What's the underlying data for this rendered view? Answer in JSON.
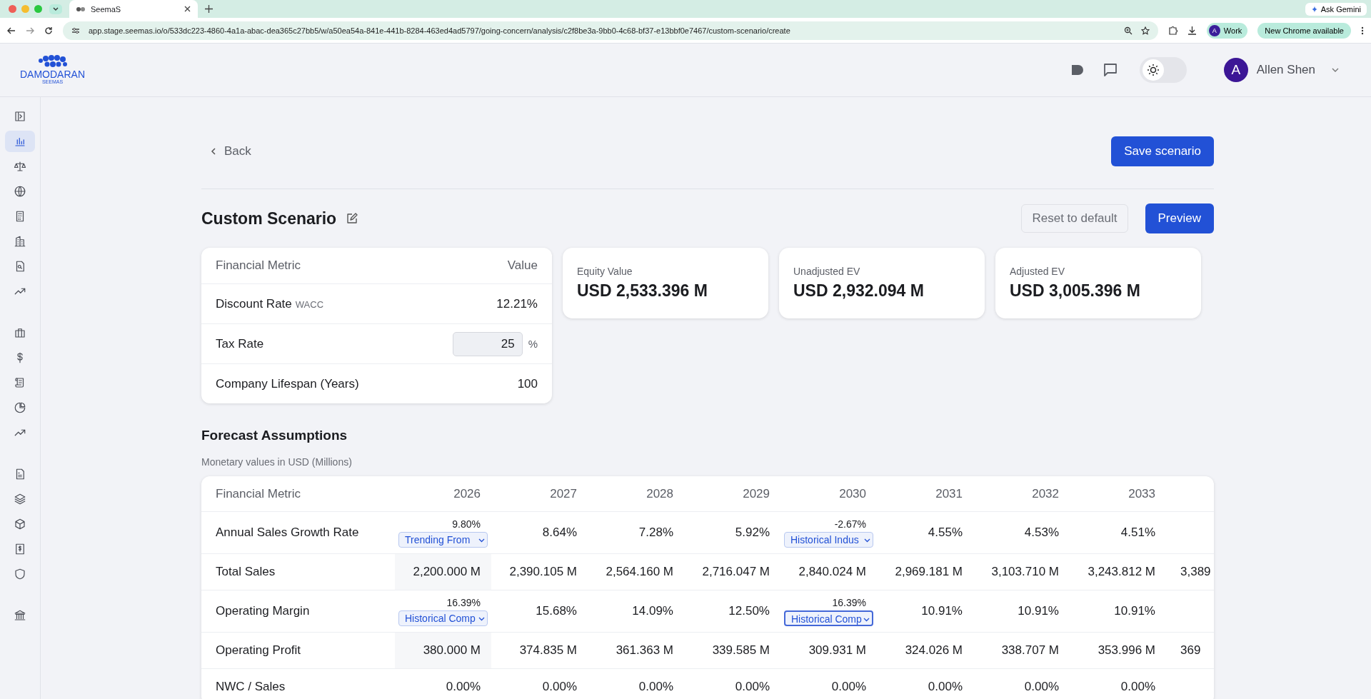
{
  "browser": {
    "tab_title": "SeemaS",
    "url": "app.stage.seemas.io/o/533dc223-4860-4a1a-abac-dea365c27bb5/w/a50ea54a-841e-441b-8284-463ed4ad5797/going-concern/analysis/c2f8be3a-9bb0-4c68-bf37-e13bbf0e7467/custom-scenario/create",
    "profile_initial": "A",
    "profile_label": "Work",
    "update_label": "New Chrome available",
    "gemini_label": "Ask Gemini"
  },
  "header": {
    "logo_text": "DAMODARAN",
    "logo_subtext": "SEEMAS",
    "theme_dark": false,
    "user_initial": "A",
    "user_name": "Allen Shen"
  },
  "sidebar": {
    "groups": [
      [
        {
          "selected": false
        },
        {
          "selected": true
        },
        {
          "selected": false
        },
        {
          "selected": false
        },
        {
          "selected": false
        },
        {
          "selected": false
        },
        {
          "selected": false
        },
        {
          "selected": false
        }
      ],
      [
        {
          "selected": false
        },
        {
          "selected": false
        },
        {
          "selected": false
        },
        {
          "selected": false
        },
        {
          "selected": false
        }
      ],
      [
        {
          "selected": false
        },
        {
          "selected": false
        },
        {
          "selected": false
        },
        {
          "selected": false
        },
        {
          "selected": false
        }
      ],
      [
        {
          "selected": false
        }
      ]
    ]
  },
  "back": "Back",
  "save_button": "Save scenario",
  "title": "Custom Scenario",
  "reset_button": "Reset to default",
  "preview_button": "Preview",
  "metrics_table": {
    "columns": [
      "Financial Metric",
      "Value"
    ],
    "rows": [
      {
        "kind": "text",
        "label": "Discount Rate",
        "sublabel": "WACC",
        "value": "12.21%"
      },
      {
        "kind": "input",
        "label": "Tax Rate",
        "value": "25",
        "unit": "%"
      },
      {
        "kind": "text",
        "label": "Company Lifespan (Years)",
        "value": "100"
      }
    ]
  },
  "value_cards": [
    {
      "label": "Equity Value",
      "value": "USD 2,533.396 M"
    },
    {
      "label": "Unadjusted EV",
      "value": "USD 2,932.094 M"
    },
    {
      "label": "Adjusted EV",
      "value": "USD 3,005.396 M"
    }
  ],
  "forecast": {
    "title": "Forecast Assumptions",
    "subtitle": "Monetary values in USD (Millions)",
    "columns": [
      "Financial Metric",
      "2026",
      "2027",
      "2028",
      "2029",
      "2030",
      "2031",
      "2032",
      "2033"
    ],
    "rows": [
      {
        "cells": [
          {
            "kind": "label",
            "value": "Annual Sales Growth Rate"
          },
          {
            "kind": "select",
            "value": "9.80%",
            "option": "Trending From",
            "focused": false
          },
          {
            "kind": "text",
            "value": "8.64%"
          },
          {
            "kind": "text",
            "value": "7.28%"
          },
          {
            "kind": "text",
            "value": "5.92%"
          },
          {
            "kind": "select",
            "value": "-2.67%",
            "option": "Historical Indus",
            "focused": false
          },
          {
            "kind": "text",
            "value": "4.55%"
          },
          {
            "kind": "text",
            "value": "4.53%"
          },
          {
            "kind": "text",
            "value": "4.51%"
          }
        ]
      },
      {
        "cells": [
          {
            "kind": "label",
            "value": "Total Sales"
          },
          {
            "kind": "text",
            "value": "2,200.000 M"
          },
          {
            "kind": "text",
            "value": "2,390.105 M"
          },
          {
            "kind": "text",
            "value": "2,564.160 M"
          },
          {
            "kind": "text",
            "value": "2,716.047 M"
          },
          {
            "kind": "text",
            "value": "2,840.024 M"
          },
          {
            "kind": "text",
            "value": "2,969.181 M"
          },
          {
            "kind": "text",
            "value": "3,103.710 M"
          },
          {
            "kind": "text",
            "value": "3,243.812 M"
          },
          {
            "kind": "text",
            "value": "3,389"
          }
        ]
      },
      {
        "cells": [
          {
            "kind": "label",
            "value": "Operating Margin"
          },
          {
            "kind": "select",
            "value": "16.39%",
            "option": "Historical Comp",
            "focused": false
          },
          {
            "kind": "text",
            "value": "15.68%"
          },
          {
            "kind": "text",
            "value": "14.09%"
          },
          {
            "kind": "text",
            "value": "12.50%"
          },
          {
            "kind": "select",
            "value": "16.39%",
            "option": "Historical Comp",
            "focused": true
          },
          {
            "kind": "text",
            "value": "10.91%"
          },
          {
            "kind": "text",
            "value": "10.91%"
          },
          {
            "kind": "text",
            "value": "10.91%"
          }
        ]
      },
      {
        "cells": [
          {
            "kind": "label",
            "value": "Operating Profit"
          },
          {
            "kind": "text",
            "value": "380.000 M"
          },
          {
            "kind": "text",
            "value": "374.835 M"
          },
          {
            "kind": "text",
            "value": "361.363 M"
          },
          {
            "kind": "text",
            "value": "339.585 M"
          },
          {
            "kind": "text",
            "value": "309.931 M"
          },
          {
            "kind": "text",
            "value": "324.026 M"
          },
          {
            "kind": "text",
            "value": "338.707 M"
          },
          {
            "kind": "text",
            "value": "353.996 M"
          },
          {
            "kind": "text",
            "value": "369"
          }
        ]
      },
      {
        "cells": [
          {
            "kind": "label",
            "value": "NWC / Sales"
          },
          {
            "kind": "text",
            "value": "0.00%"
          },
          {
            "kind": "text",
            "value": "0.00%"
          },
          {
            "kind": "text",
            "value": "0.00%"
          },
          {
            "kind": "text",
            "value": "0.00%"
          },
          {
            "kind": "text",
            "value": "0.00%"
          },
          {
            "kind": "text",
            "value": "0.00%"
          },
          {
            "kind": "text",
            "value": "0.00%"
          },
          {
            "kind": "text",
            "value": "0.00%"
          }
        ]
      }
    ]
  }
}
